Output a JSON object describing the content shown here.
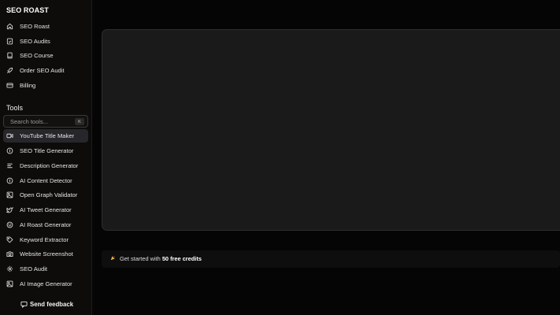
{
  "brand": "SEO ROAST",
  "nav": [
    {
      "label": "SEO Roast",
      "icon": "home-icon"
    },
    {
      "label": "SEO Audits",
      "icon": "document-check-icon"
    },
    {
      "label": "SEO Course",
      "icon": "book-icon"
    },
    {
      "label": "Order SEO Audit",
      "icon": "rocket-icon"
    },
    {
      "label": "Billing",
      "icon": "credit-card-icon"
    }
  ],
  "tools": {
    "title": "Tools",
    "search_placeholder": "Search tools...",
    "search_shortcut": "K",
    "items": [
      {
        "label": "YouTube Title Maker",
        "icon": "video-icon",
        "active": true
      },
      {
        "label": "SEO Title Generator",
        "icon": "info-circle-icon"
      },
      {
        "label": "Description Generator",
        "icon": "text-lines-icon"
      },
      {
        "label": "AI Content Detector",
        "icon": "info-circle-icon"
      },
      {
        "label": "Open Graph Validator",
        "icon": "image-icon"
      },
      {
        "label": "AI Tweet Generator",
        "icon": "twitter-icon"
      },
      {
        "label": "AI Roast Generator",
        "icon": "smile-icon"
      },
      {
        "label": "Keyword Extractor",
        "icon": "tag-icon"
      },
      {
        "label": "Website Screenshot",
        "icon": "camera-icon"
      },
      {
        "label": "SEO Audit",
        "icon": "gear-icon"
      },
      {
        "label": "AI Image Generator",
        "icon": "image-icon"
      }
    ]
  },
  "feedback_label": "Send feedback",
  "credits": {
    "prefix": "Get started with ",
    "highlight": "50 free credits"
  }
}
